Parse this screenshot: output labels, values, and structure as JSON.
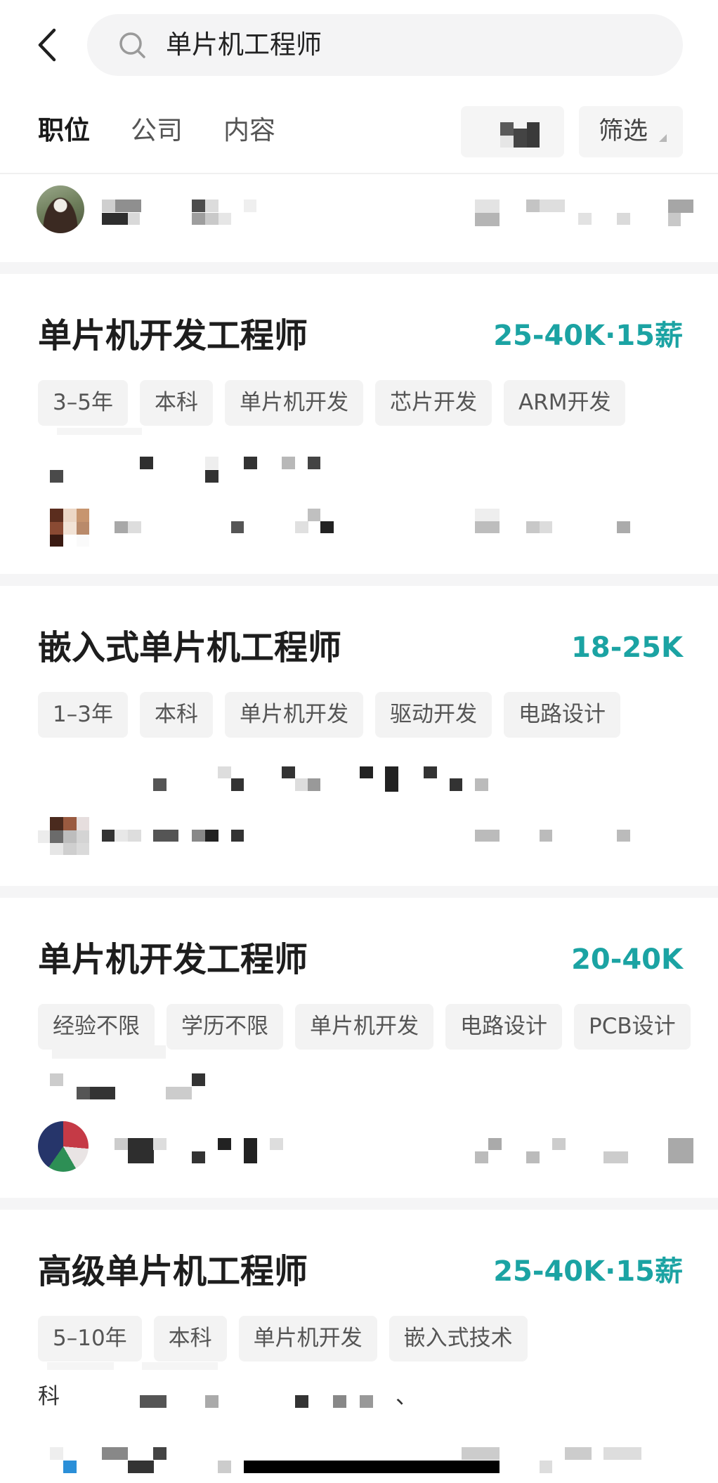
{
  "header": {
    "back_icon": "back-arrow-icon",
    "search": {
      "icon": "search-icon",
      "value": "单片机工程师"
    }
  },
  "tabs": [
    {
      "label": "职位",
      "active": true
    },
    {
      "label": "公司",
      "active": false
    },
    {
      "label": "内容",
      "active": false
    }
  ],
  "toolbar": {
    "filter_label": "筛选",
    "filter_icon": "dropdown-corner-icon"
  },
  "colors": {
    "salary_accent": "#1ba3a3",
    "tag_background": "#f3f3f3",
    "section_separator": "#f5f5f6",
    "search_background": "#f4f4f5"
  },
  "jobs": [
    {
      "title": "单片机开发工程师",
      "salary": "25-40K·15薪",
      "tags": [
        "3–5年",
        "本科",
        "单片机开发",
        "芯片开发",
        "ARM开发"
      ]
    },
    {
      "title": "嵌入式单片机工程师",
      "salary": "18-25K",
      "tags": [
        "1–3年",
        "本科",
        "单片机开发",
        "驱动开发",
        "电路设计"
      ]
    },
    {
      "title": "单片机开发工程师",
      "salary": "20-40K",
      "tags": [
        "经验不限",
        "学历不限",
        "单片机开发",
        "电路设计",
        "PCB设计"
      ]
    },
    {
      "title": "高级单片机工程师",
      "salary": "25-40K·15薪",
      "tags": [
        "5–10年",
        "本科",
        "单片机开发",
        "嵌入式技术"
      ],
      "company_text_fragment": "科",
      "company_punct_fragment": "、"
    }
  ]
}
